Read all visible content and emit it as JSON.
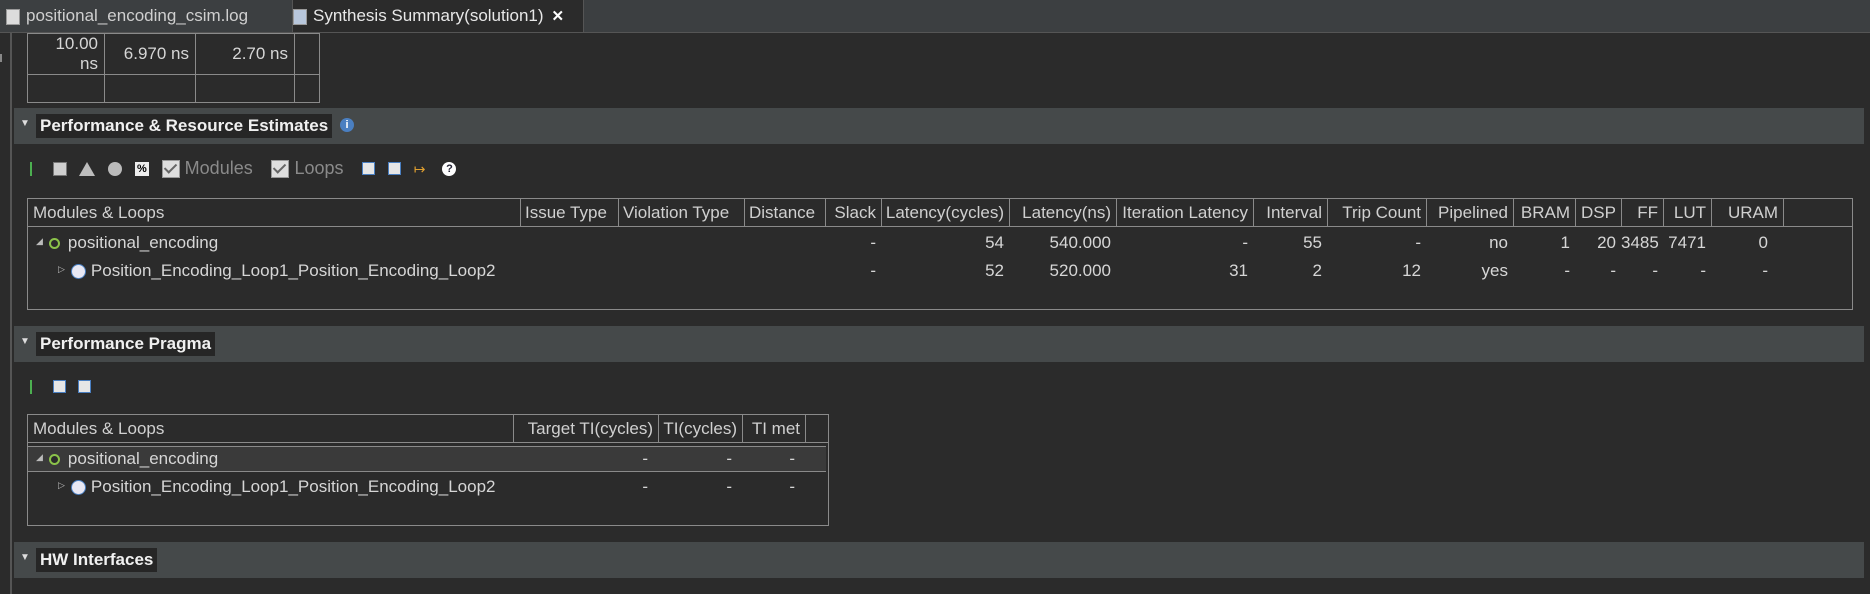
{
  "tabs": [
    {
      "label": "positional_encoding_csim.log",
      "icon": "file-icon"
    },
    {
      "label": "Synthesis Summary(solution1)",
      "icon": "report-icon",
      "close": "✕"
    }
  ],
  "timing_table": {
    "rows": [
      [
        "10.00 ns",
        "6.970 ns",
        "2.70 ns",
        ""
      ],
      [
        "",
        "",
        "",
        ""
      ]
    ]
  },
  "perf_section": {
    "title": "Performance & Resource Estimates",
    "info_icon": "i",
    "toolbar": {
      "modules_label": "Modules",
      "loops_label": "Loops"
    },
    "columns": [
      "Modules & Loops",
      "Issue Type",
      "Violation Type",
      "Distance",
      "Slack",
      "Latency(cycles)",
      "Latency(ns)",
      "Iteration Latency",
      "Interval",
      "Trip Count",
      "Pipelined",
      "BRAM",
      "DSP",
      "FF",
      "LUT",
      "URAM"
    ],
    "rows": [
      {
        "name": "positional_encoding",
        "expander": "◢",
        "icon": "module-dot-icon",
        "cells": [
          "",
          "",
          "",
          "-",
          "54",
          "540.000",
          "-",
          "55",
          "-",
          "no",
          "1",
          "20",
          "3485",
          "7471",
          "0"
        ]
      },
      {
        "name": "Position_Encoding_Loop1_Position_Encoding_Loop2",
        "expander": "▷",
        "icon": "loop-icon",
        "cells": [
          "",
          "",
          "",
          "-",
          "52",
          "520.000",
          "31",
          "2",
          "12",
          "yes",
          "-",
          "-",
          "-",
          "-",
          "-"
        ]
      }
    ]
  },
  "pragma_section": {
    "title": "Performance Pragma",
    "columns": [
      "Modules & Loops",
      "Target TI(cycles)",
      "TI(cycles)",
      "TI met"
    ],
    "rows": [
      {
        "name": "positional_encoding",
        "expander": "◢",
        "icon": "module-dot-icon",
        "cells": [
          "-",
          "-",
          "-"
        ]
      },
      {
        "name": "Position_Encoding_Loop1_Position_Encoding_Loop2",
        "expander": "▷",
        "icon": "loop-icon",
        "cells": [
          "-",
          "-",
          "-"
        ]
      }
    ]
  },
  "hw_section": {
    "title": "HW Interfaces"
  }
}
